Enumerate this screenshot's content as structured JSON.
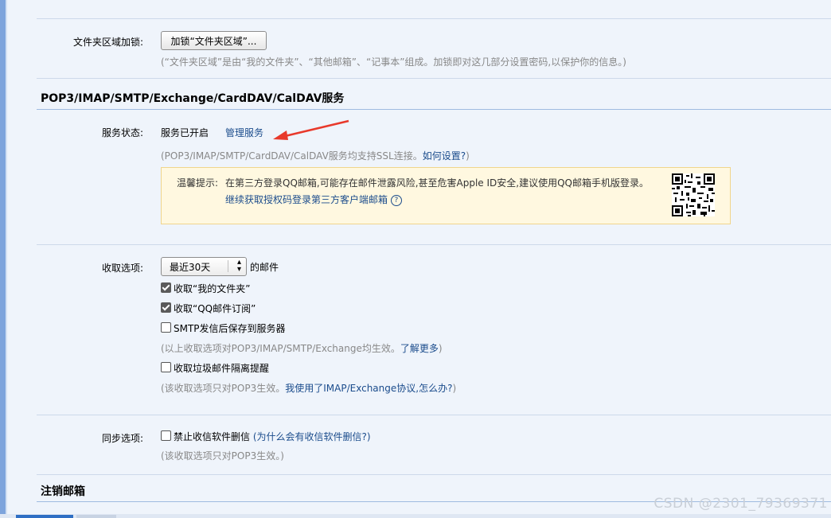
{
  "folder_lock": {
    "label": "文件夹区域加锁:",
    "button_label": "加锁“文件夹区域”...",
    "hint": "(“文件夹区域”是由“我的文件夹”、“其他邮箱”、“记事本”组成。加锁即对这几部分设置密码,以保护你的信息。)"
  },
  "service_section": {
    "title": "POP3/IMAP/SMTP/Exchange/CardDAV/CalDAV服务",
    "status_label": "服务状态:",
    "status_value": "服务已开启",
    "manage_link": "管理服务",
    "ssl_hint_prefix": "(POP3/IMAP/SMTP/CardDAV/CalDAV服务均支持SSL连接。",
    "ssl_hint_link": "如何设置?",
    "ssl_hint_suffix": ")",
    "warning_label": "温馨提示:",
    "warning_text": "在第三方登录QQ邮箱,可能存在邮件泄露风险,甚至危害Apple ID安全,建议使用QQ邮箱手机版登录。",
    "warning_link": "继续获取授权码登录第三方客户端邮箱",
    "warning_help": "?"
  },
  "receive_options": {
    "label": "收取选项:",
    "range_selected": "最近30天",
    "range_suffix": "的邮件",
    "options": [
      {
        "label": "收取“我的文件夹”",
        "checked": true
      },
      {
        "label": "收取“QQ邮件订阅”",
        "checked": true
      },
      {
        "label": "SMTP发信后保存到服务器",
        "checked": false
      }
    ],
    "hint1_prefix": "(以上收取选项对POP3/IMAP/SMTP/Exchange均生效。",
    "hint1_link": "了解更多",
    "hint1_suffix": ")",
    "spam_option": {
      "label": "收取垃圾邮件隔离提醒",
      "checked": false
    },
    "hint2_prefix": "(该收取选项只对POP3生效。",
    "hint2_link": "我使用了IMAP/Exchange协议,怎么办?",
    "hint2_suffix": ")"
  },
  "sync_options": {
    "label": "同步选项:",
    "option": {
      "label": "禁止收信软件删信",
      "checked": false
    },
    "option_link": "(为什么会有收信软件删信?)",
    "hint": "(该收取选项只对POP3生效。)"
  },
  "cancel_section": {
    "title": "注销邮箱"
  },
  "watermark": "CSDN @2301_79369371",
  "colors": {
    "page_bg": "#eff4fb",
    "link": "#1b4c8c",
    "annotation_arrow": "#e8392b",
    "warning_bg": "#fff8e0"
  }
}
